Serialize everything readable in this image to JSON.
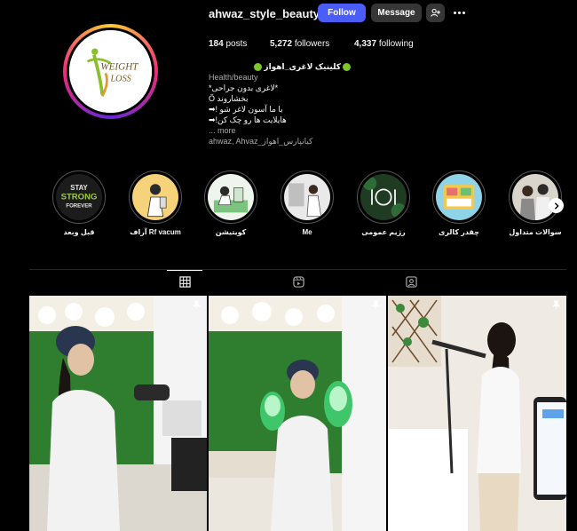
{
  "profile": {
    "username": "ahwaz_style_beauty",
    "avatar_text_1": "WEIGHT",
    "avatar_text_2": "LOSS",
    "follow_label": "Follow",
    "message_label": "Message",
    "add_user_icon": "add-user-icon",
    "more_icon": "more-icon"
  },
  "stats": {
    "posts_count": "184",
    "posts_label": "posts",
    "followers_count": "5,272",
    "followers_label": "followers",
    "following_count": "4,337",
    "following_label": "following"
  },
  "bio": {
    "name": "کلینیک لاغری_اهواز",
    "category": "Health/beauty",
    "line1": "*لاغری بدون جراحی*",
    "line2": "Ő بخشاروند",
    "line3": "با ما آسون لاغر شو !➡",
    "line4": "هایلایت ها رو چک کن!➡",
    "more": "... more",
    "location": "ahwaz, Ahvaz_کیانپارس_اهواز"
  },
  "highlights": [
    {
      "label": "قبل وبعد",
      "badge_1": "STAY",
      "badge_2": "STRONG",
      "badge_3": "FOREVER"
    },
    {
      "label": "آراف Rf vacum"
    },
    {
      "label": "کویتیشن"
    },
    {
      "label": "Me"
    },
    {
      "label": "رژیم عمومی"
    },
    {
      "label": "چقدر کالری"
    },
    {
      "label": "سوالات متداول"
    }
  ],
  "tabs": [
    {
      "name": "posts-tab",
      "icon": "grid-icon",
      "active": true
    },
    {
      "name": "reels-tab",
      "icon": "reels-icon",
      "active": false
    },
    {
      "name": "tagged-tab",
      "icon": "tagged-icon",
      "active": false
    }
  ],
  "colors": {
    "background": "#000000",
    "follow_button": "#4a5df9",
    "secondary_button": "#363636",
    "muted_text": "#a8a8a8"
  }
}
